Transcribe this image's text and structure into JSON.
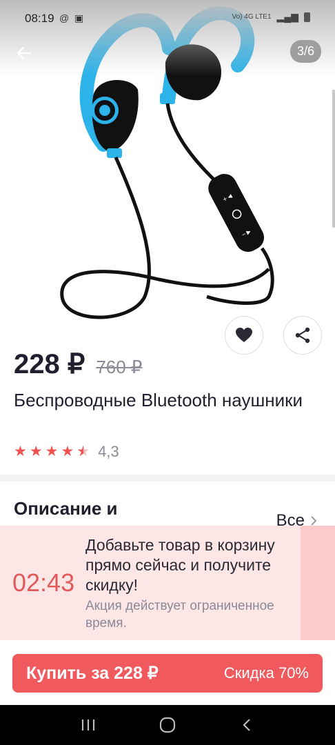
{
  "status": {
    "time": "08:19",
    "network_label": "Vo) 4G LTE1"
  },
  "header": {
    "image_counter": "3/6"
  },
  "product": {
    "price": "228 ₽",
    "old_price": "760 ₽",
    "title": "Беспроводные Bluetooth наушники",
    "rating": 4.3,
    "rating_text": "4,3"
  },
  "description": {
    "title": "Описание и",
    "all_label": "Все"
  },
  "promo": {
    "timer": "02:43",
    "headline": "Добавьте товар в корзину прямо сейчас и получите скидку!",
    "subtext": "Акция действует ограниченное время."
  },
  "buy": {
    "label": "Купить за 228 ₽",
    "discount": "Скидка 70%"
  },
  "colors": {
    "accent": "#f05a5e",
    "star": "#ef5350",
    "promo_bg": "#fde6e6",
    "timer": "#e05a5a",
    "earbud_blue": "#2bb3ea"
  },
  "icons": [
    "back-arrow-icon",
    "heart-icon",
    "share-icon",
    "star-icon",
    "chevron-right-icon",
    "recent-apps-icon",
    "home-icon",
    "nav-back-icon"
  ]
}
